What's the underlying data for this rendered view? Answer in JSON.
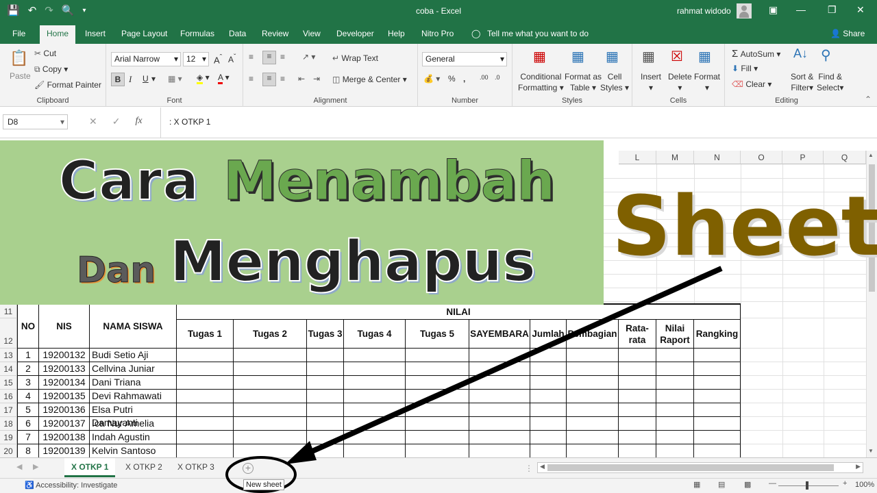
{
  "window": {
    "doc_title": "coba  -  Excel",
    "user": "rahmat widodo"
  },
  "tabs": [
    "File",
    "Home",
    "Insert",
    "Page Layout",
    "Formulas",
    "Data",
    "Review",
    "View",
    "Developer",
    "Help",
    "Nitro Pro",
    "Tell me what you want to do"
  ],
  "share_label": "Share",
  "ribbon": {
    "clipboard": {
      "paste": "Paste",
      "cut": "Cut",
      "copy": "Copy",
      "format_painter": "Format Painter",
      "label": "Clipboard"
    },
    "font": {
      "name": "Arial Narrow",
      "size": "12",
      "label": "Font"
    },
    "alignment": {
      "wrap": "Wrap Text",
      "merge": "Merge & Center",
      "label": "Alignment"
    },
    "number": {
      "format": "General",
      "label": "Number"
    },
    "styles": {
      "conditional": [
        "Conditional",
        "Formatting"
      ],
      "format_table": [
        "Format as",
        "Table"
      ],
      "cell_styles": [
        "Cell",
        "Styles"
      ],
      "label": "Styles"
    },
    "cells": {
      "insert": "Insert",
      "delete": "Delete",
      "format": "Format",
      "label": "Cells"
    },
    "editing": {
      "autosum": "AutoSum",
      "fill": "Fill",
      "clear": "Clear",
      "sort": [
        "Sort &",
        "Filter"
      ],
      "find": [
        "Find &",
        "Select"
      ],
      "label": "Editing"
    }
  },
  "formula_bar": {
    "name_box": "D8",
    "formula": ": X OTKP 1"
  },
  "columns": [
    "L",
    "M",
    "N",
    "O",
    "P",
    "Q"
  ],
  "row_numbers": [
    "11",
    "12",
    "13",
    "14",
    "15",
    "16",
    "17",
    "18",
    "19",
    "20"
  ],
  "table": {
    "nilai": "NILAI",
    "headers": [
      "NO",
      "NIS",
      "NAMA SISWA",
      "Tugas 1",
      "Tugas 2",
      "Tugas 3",
      "Tugas 4",
      "Tugas 5",
      "SAYEMBARA",
      "Jumlah",
      "Pembagian",
      "Rata-rata",
      "Nilai Raport",
      "Rangking"
    ],
    "rows": [
      {
        "no": "1",
        "nis": "19200132",
        "nama": "Budi Setio Aji"
      },
      {
        "no": "2",
        "nis": "19200133",
        "nama": "Cellvina Juniar"
      },
      {
        "no": "3",
        "nis": "19200134",
        "nama": "Dani Triana"
      },
      {
        "no": "4",
        "nis": "19200135",
        "nama": "Devi Rahmawati"
      },
      {
        "no": "5",
        "nis": "19200136",
        "nama": "Elsa Putri Damayanti"
      },
      {
        "no": "6",
        "nis": "19200137",
        "nama": "Ica Nur Amelia"
      },
      {
        "no": "7",
        "nis": "19200138",
        "nama": "Indah Agustin"
      },
      {
        "no": "8",
        "nis": "19200139",
        "nama": "Kelvin Santoso"
      }
    ]
  },
  "overlay": {
    "cara": "Cara",
    "menambah": "Menambah",
    "dan": "Dan",
    "menghapus": "Menghapus",
    "sheet": "Sheet"
  },
  "sheet_tabs": [
    "X OTKP 1",
    "X OTKP 2",
    "X OTKP 3"
  ],
  "new_sheet_tooltip": "New sheet",
  "status": {
    "accessibility": "Accessibility: Investigate",
    "zoom": "100%"
  },
  "colors": {
    "excel_green": "#217346",
    "banner_green": "#a9d08e",
    "sheet_brown": "#7f6000"
  }
}
